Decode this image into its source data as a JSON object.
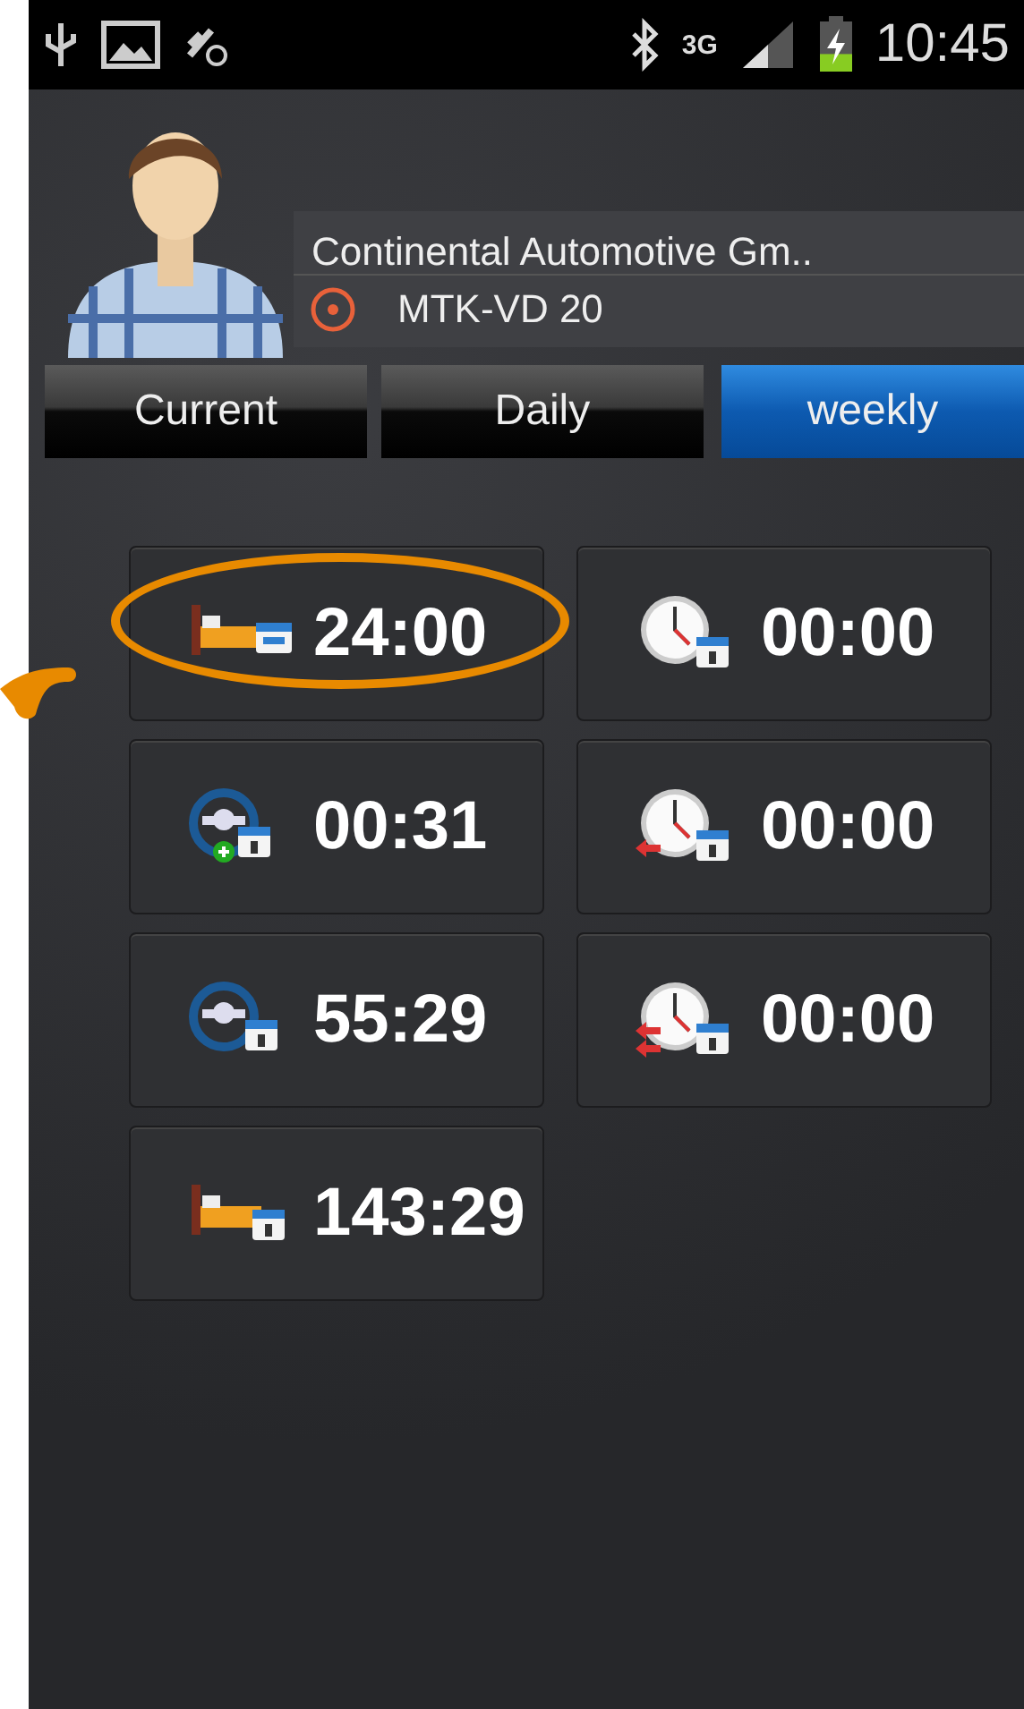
{
  "status_bar": {
    "network": "3G",
    "time": "10:45",
    "battery": {
      "level": 0.35,
      "charging": true
    }
  },
  "header": {
    "company": "Continental Automotive Gm..",
    "vehicle": "MTK-VD 20"
  },
  "tabs": [
    {
      "label": "Current",
      "selected": false
    },
    {
      "label": "Daily",
      "selected": false
    },
    {
      "label": "weekly",
      "selected": true
    }
  ],
  "tiles": [
    {
      "kind": "rest-day",
      "value": "24:00",
      "highlighted": true
    },
    {
      "kind": "clock",
      "value": "00:00",
      "highlighted": false
    },
    {
      "kind": "drive-extra",
      "value": "00:31",
      "highlighted": false
    },
    {
      "kind": "clock-back",
      "value": "00:00",
      "highlighted": false
    },
    {
      "kind": "drive",
      "value": "55:29",
      "highlighted": false
    },
    {
      "kind": "clock-swap",
      "value": "00:00",
      "highlighted": false
    },
    {
      "kind": "rest-week",
      "value": "143:29",
      "highlighted": false
    }
  ]
}
